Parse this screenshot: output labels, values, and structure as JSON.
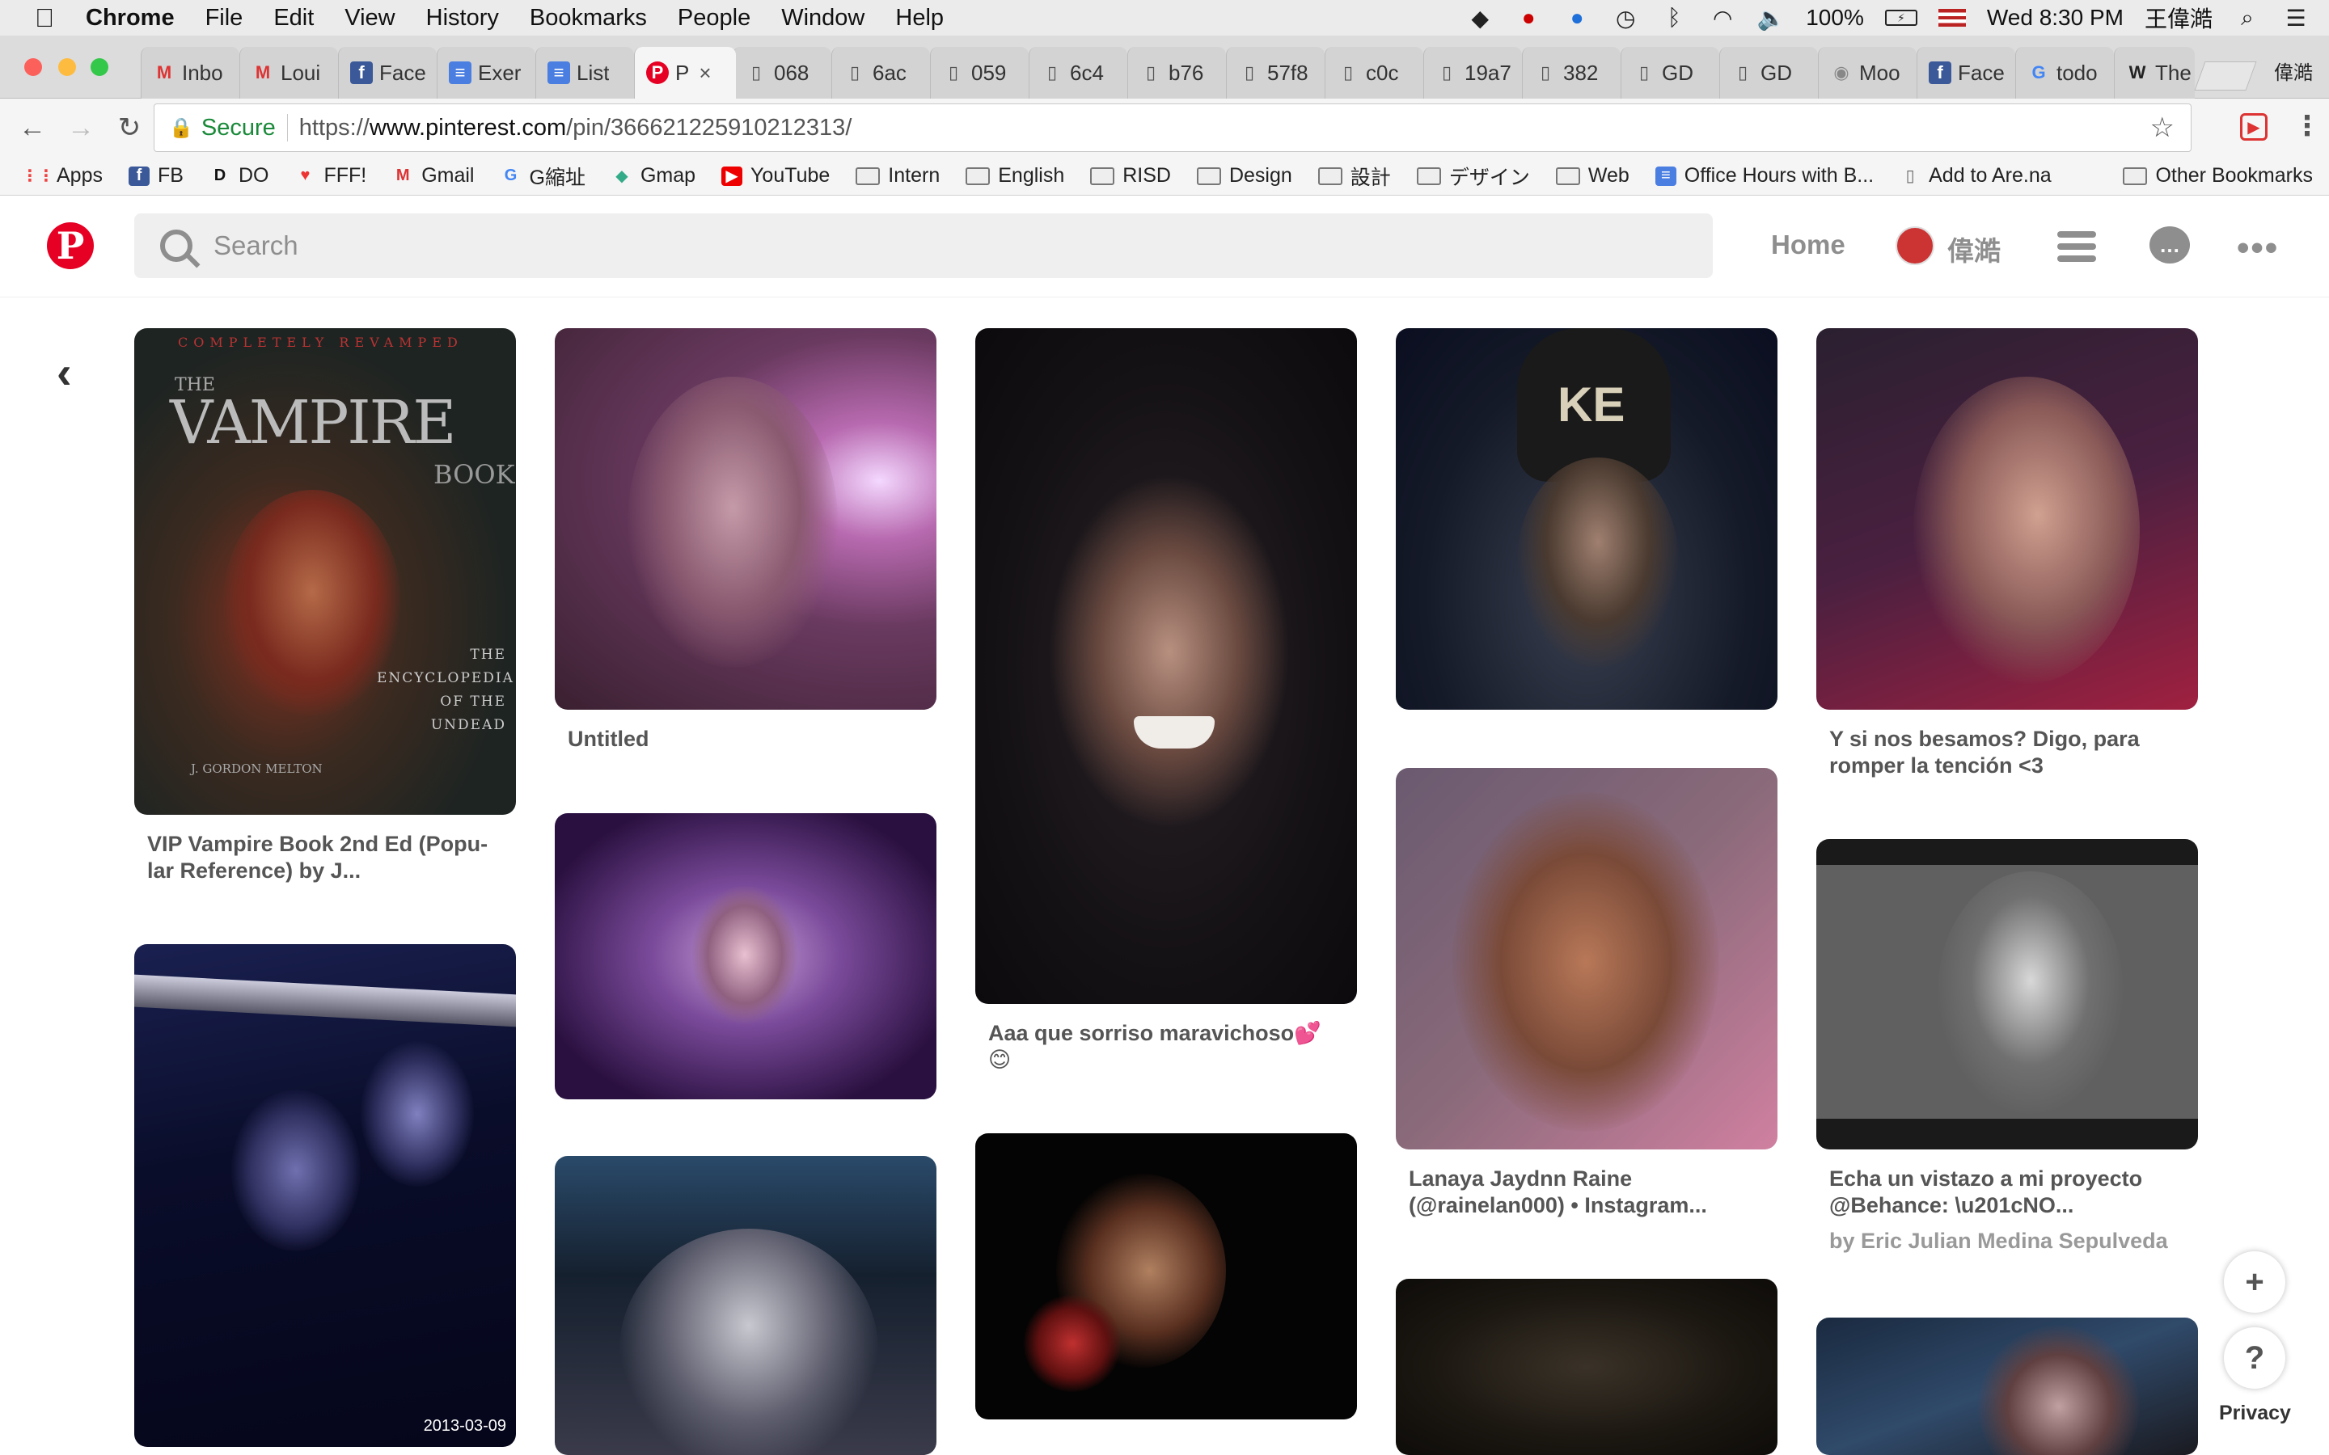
{
  "menubar": {
    "app": "Chrome",
    "items": [
      "File",
      "Edit",
      "View",
      "History",
      "Bookmarks",
      "People",
      "Window",
      "Help"
    ],
    "battery": "100%",
    "clock": "Wed 8:30 PM",
    "user": "王偉澔"
  },
  "tabs": [
    {
      "label": "Inbo",
      "icon": "M"
    },
    {
      "label": "Loui",
      "icon": "M"
    },
    {
      "label": "Face",
      "icon": "f"
    },
    {
      "label": "Exer",
      "icon": "≡"
    },
    {
      "label": "List",
      "icon": "≡"
    },
    {
      "label": "P",
      "icon": "P"
    },
    {
      "label": "068",
      "icon": "▯"
    },
    {
      "label": "6ac",
      "icon": "▯"
    },
    {
      "label": "059",
      "icon": "▯"
    },
    {
      "label": "6c4",
      "icon": "▯"
    },
    {
      "label": "b76",
      "icon": "▯"
    },
    {
      "label": "57f8",
      "icon": "▯"
    },
    {
      "label": "c0c",
      "icon": "▯"
    },
    {
      "label": "19a7",
      "icon": "▯"
    },
    {
      "label": "382",
      "icon": "▯"
    },
    {
      "label": "GD",
      "icon": "▯"
    },
    {
      "label": "GD",
      "icon": "▯"
    },
    {
      "label": "Moo",
      "icon": "◉"
    },
    {
      "label": "Face",
      "icon": "f"
    },
    {
      "label": "todo",
      "icon": "G"
    },
    {
      "label": "The",
      "icon": "W"
    }
  ],
  "profile_name": "偉澔",
  "omnibox": {
    "secure": "Secure",
    "url_prefix": "https://",
    "url_domain": "www.pinterest.com",
    "url_path": "/pin/366621225910212313/"
  },
  "bookmarks": [
    {
      "label": "Apps",
      "icon": "⋮⋮"
    },
    {
      "label": "FB",
      "icon": "f"
    },
    {
      "label": "DO",
      "icon": "D"
    },
    {
      "label": "FFF!",
      "icon": "♥"
    },
    {
      "label": "Gmail",
      "icon": "M"
    },
    {
      "label": "G縮址",
      "icon": "G"
    },
    {
      "label": "Gmap",
      "icon": "◆"
    },
    {
      "label": "YouTube",
      "icon": "▶"
    },
    {
      "label": "Intern",
      "icon": "folder"
    },
    {
      "label": "English",
      "icon": "folder"
    },
    {
      "label": "RISD",
      "icon": "folder"
    },
    {
      "label": "Design",
      "icon": "folder"
    },
    {
      "label": "設計",
      "icon": "folder"
    },
    {
      "label": "デザイン",
      "icon": "folder"
    },
    {
      "label": "Web",
      "icon": "folder"
    },
    {
      "label": "Office Hours with B...",
      "icon": "≡"
    },
    {
      "label": "Add to Are.na",
      "icon": "▯"
    }
  ],
  "other_bookmarks": "Other Bookmarks",
  "pinterest": {
    "search_placeholder": "Search",
    "home": "Home",
    "user": "偉澔"
  },
  "pins": [
    {
      "caption": "VIP Vampire Book 2nd Ed (Popu-lar Reference) by J...",
      "book_top": "COMPLETELY REVAMPED",
      "book_the": "THE",
      "book_title": "VAMPIRE",
      "book_sub": "BOOK",
      "book_ency": "THE ENCYCLOPEDIA OF THE UNDEAD",
      "book_author": "J. GORDON MELTON"
    },
    {
      "caption": "Untitled"
    },
    {
      "caption": "Aaa que sorriso maravichoso💕 😊"
    },
    {
      "caption": ""
    },
    {
      "caption": "Y si nos besamos? Digo, para romper la tención <3"
    },
    {
      "caption": "",
      "date": "2013-03-09"
    },
    {
      "caption": ""
    },
    {
      "caption": "Lanaya Jaydnn Raine (@rainelan000) • Instagram..."
    },
    {
      "caption": "Echa un vistazo a mi proyecto @Behance: \\u201cNO...",
      "sub": "by Eric Julian Medina Sepulveda"
    },
    {
      "caption": ""
    },
    {
      "caption": ""
    },
    {
      "caption": ""
    }
  ],
  "side": {
    "privacy": "Privacy",
    "plus": "+",
    "help": "?"
  }
}
